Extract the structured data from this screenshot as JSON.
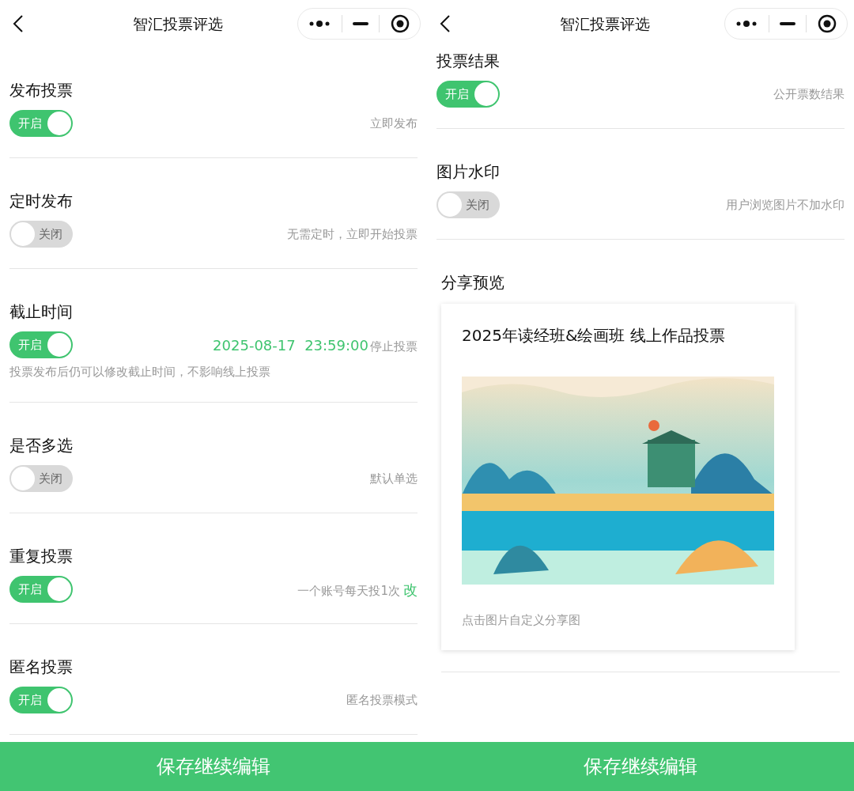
{
  "screens": [
    {
      "title": "智汇投票评选",
      "sections": [
        {
          "title": "发布投票",
          "toggle": {
            "on": true,
            "label": "开启"
          },
          "right": [
            {
              "kind": "hint",
              "text": "立即发布"
            }
          ]
        },
        {
          "title": "定时发布",
          "toggle": {
            "on": false,
            "label": "关闭"
          },
          "right": [
            {
              "kind": "hint",
              "text": "无需定时，立即开始投票"
            }
          ]
        },
        {
          "title": "截止时间",
          "toggle": {
            "on": true,
            "label": "开启"
          },
          "right": [
            {
              "kind": "value",
              "text": "2025-08-17  23:59:00"
            },
            {
              "kind": "hint",
              "text": "停止投票"
            }
          ],
          "note": "投票发布后仍可以修改截止时间，不影响线上投票"
        },
        {
          "title": "是否多选",
          "toggle": {
            "on": false,
            "label": "关闭"
          },
          "right": [
            {
              "kind": "hint",
              "text": "默认单选"
            }
          ]
        },
        {
          "title": "重复投票",
          "toggle": {
            "on": true,
            "label": "开启"
          },
          "right": [
            {
              "kind": "hint",
              "text": "一个账号每天投1次"
            },
            {
              "kind": "action",
              "text": "改"
            }
          ]
        },
        {
          "title": "匿名投票",
          "toggle": {
            "on": true,
            "label": "开启"
          },
          "right": [
            {
              "kind": "hint",
              "text": "匿名投票模式"
            }
          ]
        }
      ],
      "button": "保存继续编辑"
    },
    {
      "title": "智汇投票评选",
      "sections": [
        {
          "title": "投票结果",
          "toggle": {
            "on": true,
            "label": "开启"
          },
          "right": [
            {
              "kind": "hint",
              "text": "公开票数结果"
            }
          ]
        },
        {
          "title": "图片水印",
          "toggle": {
            "on": false,
            "label": "关闭"
          },
          "right": [
            {
              "kind": "hint",
              "text": "用户浏览图片不加水印"
            }
          ]
        }
      ],
      "share_preview": {
        "title": "分享预览",
        "card_title": "2025年读经班&绘画班 线上作品投票",
        "caption": "点击图片自定义分享图"
      },
      "button": "保存继续编辑"
    }
  ]
}
